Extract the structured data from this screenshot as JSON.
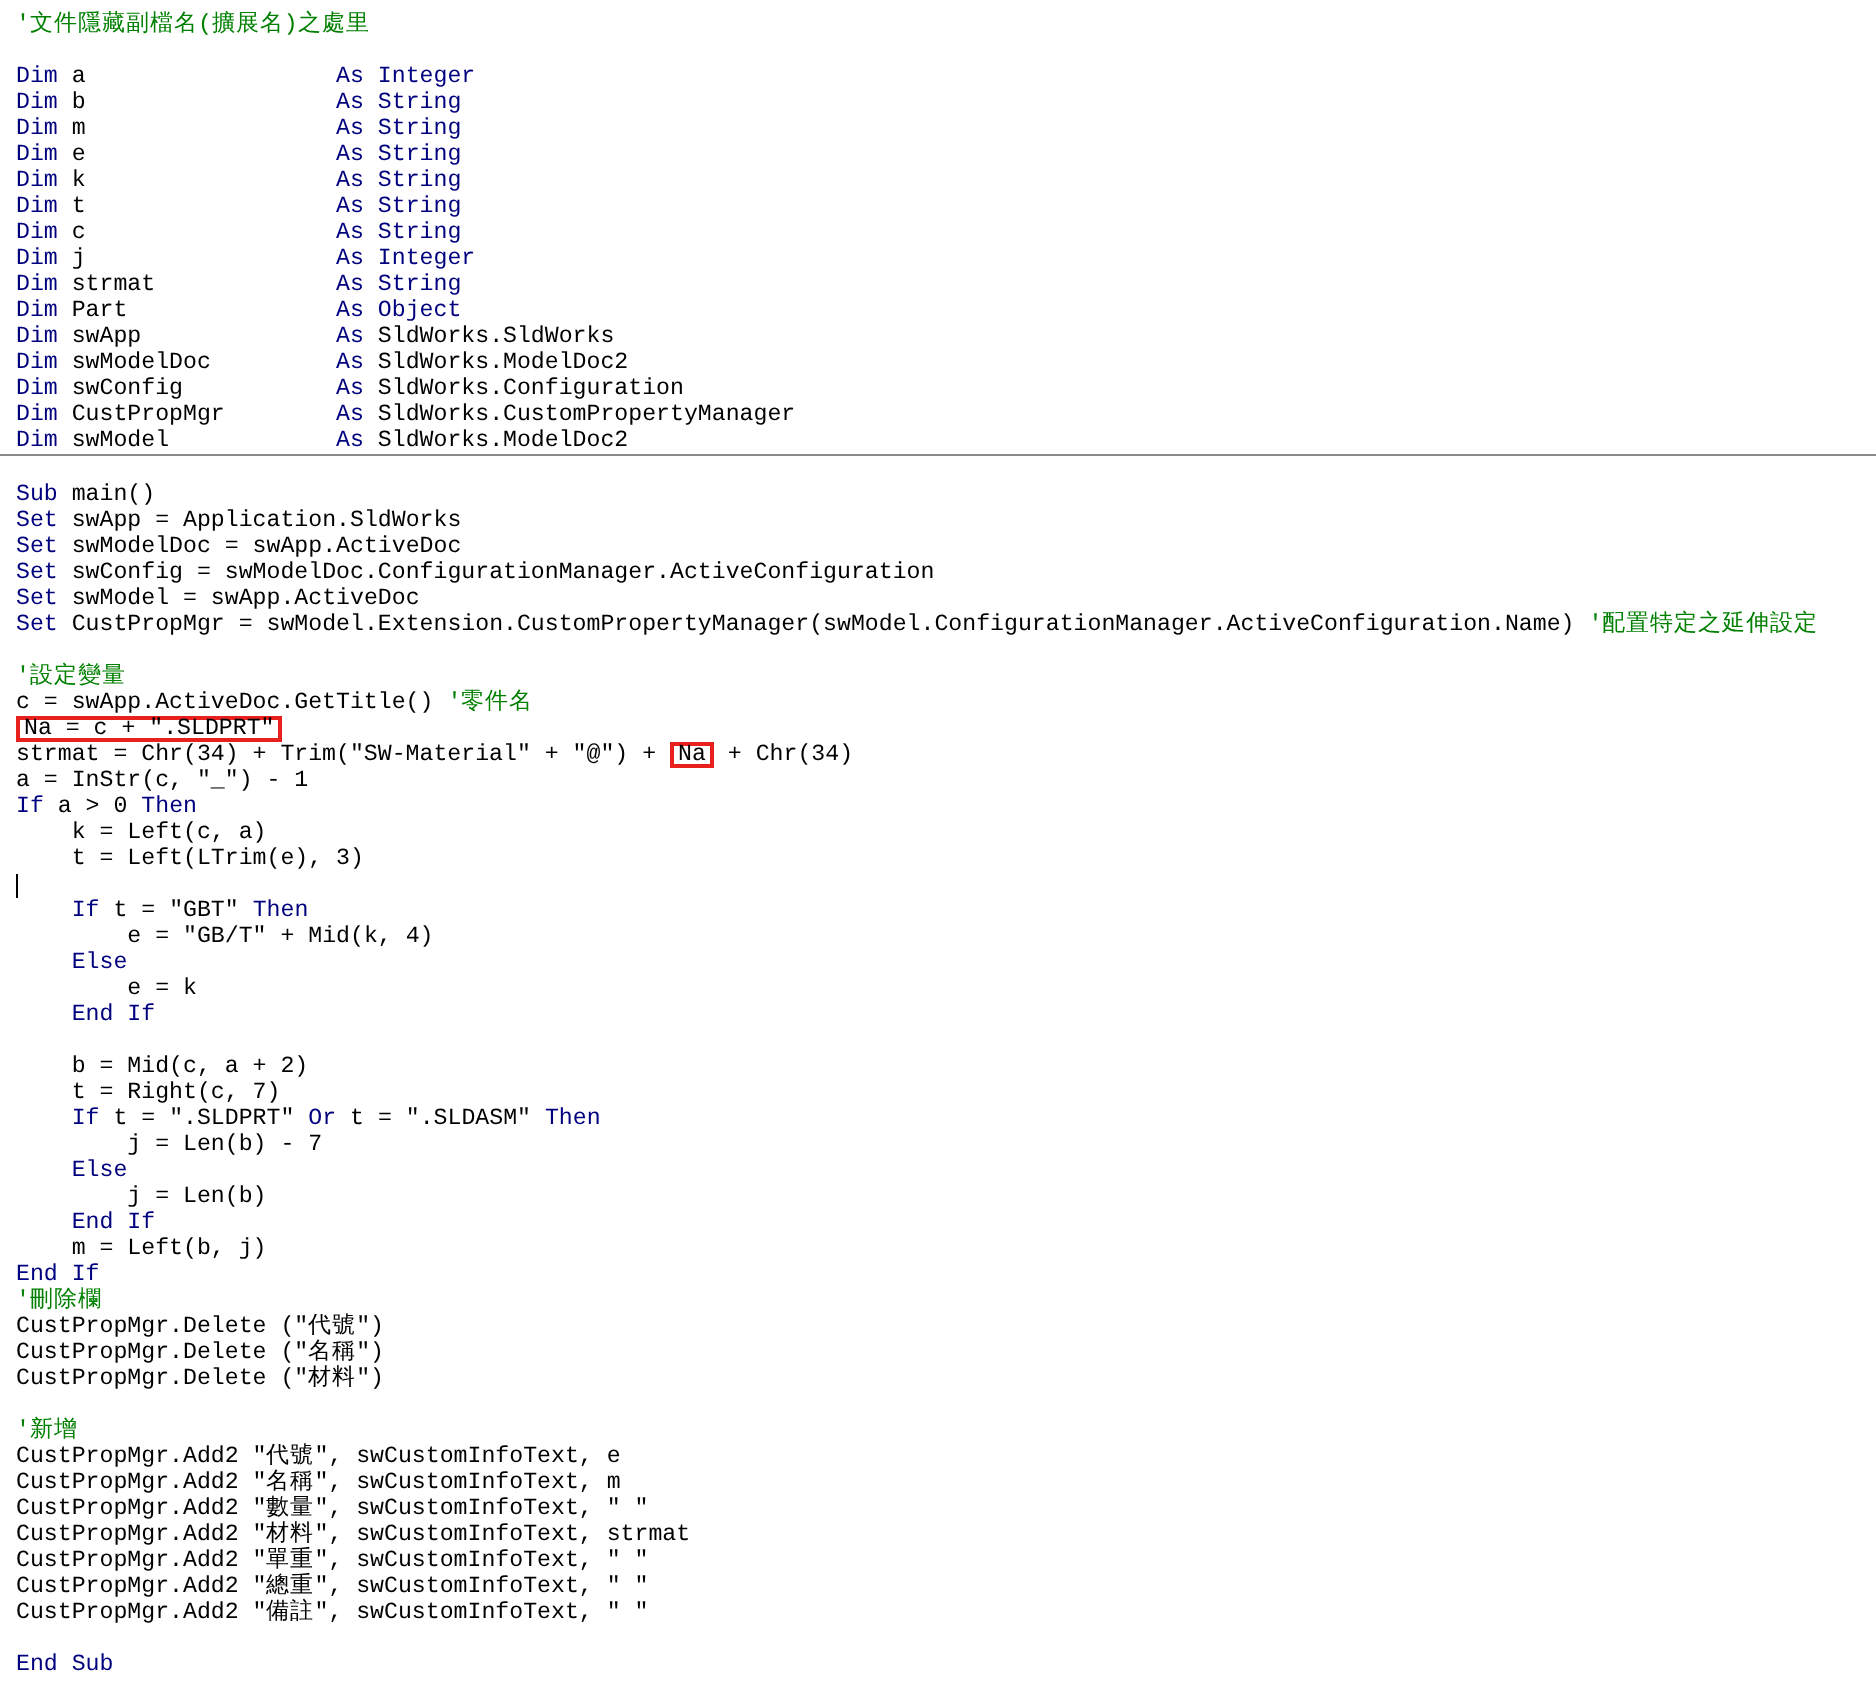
{
  "sections": [
    {
      "lines": [
        {
          "segments": [
            {
              "kind": "comment",
              "text": "'文件隱藏副檔名(擴展名)之處里"
            }
          ]
        },
        {
          "kind": "blank"
        },
        {
          "segments": [
            {
              "kind": "keyword",
              "text": "Dim"
            },
            {
              "kind": "text",
              "text": " a"
            }
          ],
          "aligned": [
            {
              "kind": "keyword",
              "text": "As"
            },
            {
              "kind": "keyword",
              "text": " Integer"
            }
          ]
        },
        {
          "segments": [
            {
              "kind": "keyword",
              "text": "Dim"
            },
            {
              "kind": "text",
              "text": " b"
            }
          ],
          "aligned": [
            {
              "kind": "keyword",
              "text": "As"
            },
            {
              "kind": "keyword",
              "text": " String"
            }
          ]
        },
        {
          "segments": [
            {
              "kind": "keyword",
              "text": "Dim"
            },
            {
              "kind": "text",
              "text": " m"
            }
          ],
          "aligned": [
            {
              "kind": "keyword",
              "text": "As"
            },
            {
              "kind": "keyword",
              "text": " String"
            }
          ]
        },
        {
          "segments": [
            {
              "kind": "keyword",
              "text": "Dim"
            },
            {
              "kind": "text",
              "text": " e"
            }
          ],
          "aligned": [
            {
              "kind": "keyword",
              "text": "As"
            },
            {
              "kind": "keyword",
              "text": " String"
            }
          ]
        },
        {
          "segments": [
            {
              "kind": "keyword",
              "text": "Dim"
            },
            {
              "kind": "text",
              "text": " k"
            }
          ],
          "aligned": [
            {
              "kind": "keyword",
              "text": "As"
            },
            {
              "kind": "keyword",
              "text": " String"
            }
          ]
        },
        {
          "segments": [
            {
              "kind": "keyword",
              "text": "Dim"
            },
            {
              "kind": "text",
              "text": " t"
            }
          ],
          "aligned": [
            {
              "kind": "keyword",
              "text": "As"
            },
            {
              "kind": "keyword",
              "text": " String"
            }
          ]
        },
        {
          "segments": [
            {
              "kind": "keyword",
              "text": "Dim"
            },
            {
              "kind": "text",
              "text": " c"
            }
          ],
          "aligned": [
            {
              "kind": "keyword",
              "text": "As"
            },
            {
              "kind": "keyword",
              "text": " String"
            }
          ]
        },
        {
          "segments": [
            {
              "kind": "keyword",
              "text": "Dim"
            },
            {
              "kind": "text",
              "text": " j"
            }
          ],
          "aligned": [
            {
              "kind": "keyword",
              "text": "As"
            },
            {
              "kind": "keyword",
              "text": " Integer"
            }
          ]
        },
        {
          "segments": [
            {
              "kind": "keyword",
              "text": "Dim"
            },
            {
              "kind": "text",
              "text": " strmat"
            }
          ],
          "aligned": [
            {
              "kind": "keyword",
              "text": "As"
            },
            {
              "kind": "keyword",
              "text": " String"
            }
          ]
        },
        {
          "segments": [
            {
              "kind": "keyword",
              "text": "Dim"
            },
            {
              "kind": "text",
              "text": " Part"
            }
          ],
          "aligned": [
            {
              "kind": "keyword",
              "text": "As"
            },
            {
              "kind": "keyword",
              "text": " Object"
            }
          ]
        },
        {
          "segments": [
            {
              "kind": "keyword",
              "text": "Dim"
            },
            {
              "kind": "text",
              "text": " swApp"
            }
          ],
          "aligned": [
            {
              "kind": "keyword",
              "text": "As"
            },
            {
              "kind": "text",
              "text": " SldWorks.SldWorks"
            }
          ]
        },
        {
          "segments": [
            {
              "kind": "keyword",
              "text": "Dim"
            },
            {
              "kind": "text",
              "text": " swModelDoc"
            }
          ],
          "aligned": [
            {
              "kind": "keyword",
              "text": "As"
            },
            {
              "kind": "text",
              "text": " SldWorks.ModelDoc2"
            }
          ]
        },
        {
          "segments": [
            {
              "kind": "keyword",
              "text": "Dim"
            },
            {
              "kind": "text",
              "text": " swConfig"
            }
          ],
          "aligned": [
            {
              "kind": "keyword",
              "text": "As"
            },
            {
              "kind": "text",
              "text": " SldWorks.Configuration"
            }
          ]
        },
        {
          "segments": [
            {
              "kind": "keyword",
              "text": "Dim"
            },
            {
              "kind": "text",
              "text": " CustPropMgr"
            }
          ],
          "aligned": [
            {
              "kind": "keyword",
              "text": "As"
            },
            {
              "kind": "text",
              "text": " SldWorks.CustomPropertyManager"
            }
          ]
        },
        {
          "segments": [
            {
              "kind": "keyword",
              "text": "Dim"
            },
            {
              "kind": "text",
              "text": " swModel"
            }
          ],
          "aligned": [
            {
              "kind": "keyword",
              "text": "As"
            },
            {
              "kind": "text",
              "text": " SldWorks.ModelDoc2"
            }
          ]
        }
      ]
    },
    {
      "lines": [
        {
          "kind": "blank"
        },
        {
          "segments": [
            {
              "kind": "keyword",
              "text": "Sub"
            },
            {
              "kind": "text",
              "text": " main()"
            }
          ]
        },
        {
          "segments": [
            {
              "kind": "keyword",
              "text": "Set"
            },
            {
              "kind": "text",
              "text": " swApp = Application.SldWorks"
            }
          ]
        },
        {
          "segments": [
            {
              "kind": "keyword",
              "text": "Set"
            },
            {
              "kind": "text",
              "text": " swModelDoc = swApp.ActiveDoc"
            }
          ]
        },
        {
          "segments": [
            {
              "kind": "keyword",
              "text": "Set"
            },
            {
              "kind": "text",
              "text": " swConfig = swModelDoc.ConfigurationManager.ActiveConfiguration"
            }
          ]
        },
        {
          "segments": [
            {
              "kind": "keyword",
              "text": "Set"
            },
            {
              "kind": "text",
              "text": " swModel = swApp.ActiveDoc"
            }
          ]
        },
        {
          "segments": [
            {
              "kind": "keyword",
              "text": "Set"
            },
            {
              "kind": "text",
              "text": " CustPropMgr = swModel.Extension.CustomPropertyManager(swModel.ConfigurationManager.ActiveConfiguration.Name)"
            },
            {
              "kind": "comment",
              "text": "'配置特定之延伸設定"
            }
          ]
        },
        {
          "kind": "blank"
        },
        {
          "segments": [
            {
              "kind": "comment",
              "text": "'設定變量"
            }
          ]
        },
        {
          "segments": [
            {
              "kind": "text",
              "text": "c = swApp.ActiveDoc.GetTitle()"
            },
            {
              "kind": "comment",
              "text": "'零件名"
            }
          ]
        },
        {
          "segments": [
            {
              "kind": "text",
              "text": "Na = c + \".SLDPRT\"",
              "boxed": true
            }
          ]
        },
        {
          "segments": [
            {
              "kind": "text",
              "text": "strmat = Chr(34) + Trim(\"SW-Material\" + \"@\") +"
            },
            {
              "kind": "text",
              "text": "Na",
              "boxed": true
            },
            {
              "kind": "text",
              "text": "+ Chr(34)"
            }
          ]
        },
        {
          "segments": [
            {
              "kind": "text",
              "text": "a = InStr(c, \"_\") - 1"
            }
          ]
        },
        {
          "segments": [
            {
              "kind": "keyword",
              "text": "If"
            },
            {
              "kind": "text",
              "text": "a > 0"
            },
            {
              "kind": "keyword",
              "text": "Then"
            }
          ]
        },
        {
          "segments": [
            {
              "kind": "text",
              "text": "    k = Left(c, a)"
            }
          ]
        },
        {
          "segments": [
            {
              "kind": "text",
              "text": "    t = Left(LTrim(e), 3)"
            }
          ]
        },
        {
          "caret": true
        },
        {
          "segments": [
            {
              "kind": "keyword",
              "text": "    If"
            },
            {
              "kind": "text",
              "text": "t = \"GBT\""
            },
            {
              "kind": "keyword",
              "text": "Then"
            }
          ]
        },
        {
          "segments": [
            {
              "kind": "text",
              "text": "        e = \"GB/T\" + Mid(k, 4)"
            }
          ]
        },
        {
          "segments": [
            {
              "kind": "keyword",
              "text": "    Else"
            }
          ]
        },
        {
          "segments": [
            {
              "kind": "text",
              "text": "        e = k"
            }
          ]
        },
        {
          "segments": [
            {
              "kind": "keyword",
              "text": "    End If"
            }
          ]
        },
        {
          "kind": "blank"
        },
        {
          "segments": [
            {
              "kind": "text",
              "text": "    b = Mid(c, a + 2)"
            }
          ]
        },
        {
          "segments": [
            {
              "kind": "text",
              "text": "    t = Right(c, 7)"
            }
          ]
        },
        {
          "segments": [
            {
              "kind": "keyword",
              "text": "    If"
            },
            {
              "kind": "text",
              "text": "t = \".SLDPRT\""
            },
            {
              "kind": "keyword",
              "text": "Or"
            },
            {
              "kind": "text",
              "text": "t = \".SLDASM\""
            },
            {
              "kind": "keyword",
              "text": "Then"
            }
          ]
        },
        {
          "segments": [
            {
              "kind": "text",
              "text": "        j = Len(b) - 7"
            }
          ]
        },
        {
          "segments": [
            {
              "kind": "keyword",
              "text": "    Else"
            }
          ]
        },
        {
          "segments": [
            {
              "kind": "text",
              "text": "        j = Len(b)"
            }
          ]
        },
        {
          "segments": [
            {
              "kind": "keyword",
              "text": "    End If"
            }
          ]
        },
        {
          "segments": [
            {
              "kind": "text",
              "text": "    m = Left(b, j)"
            }
          ]
        },
        {
          "segments": [
            {
              "kind": "keyword",
              "text": "End If"
            }
          ]
        },
        {
          "segments": [
            {
              "kind": "comment",
              "text": "'刪除欄"
            }
          ]
        },
        {
          "segments": [
            {
              "kind": "text",
              "text": "CustPropMgr.Delete (\"代號\")"
            }
          ]
        },
        {
          "segments": [
            {
              "kind": "text",
              "text": "CustPropMgr.Delete (\"名稱\")"
            }
          ]
        },
        {
          "segments": [
            {
              "kind": "text",
              "text": "CustPropMgr.Delete (\"材料\")"
            }
          ]
        },
        {
          "kind": "blank"
        },
        {
          "segments": [
            {
              "kind": "comment",
              "text": "'新增"
            }
          ]
        },
        {
          "segments": [
            {
              "kind": "text",
              "text": "CustPropMgr.Add2 \"代號\", swCustomInfoText, e"
            }
          ]
        },
        {
          "segments": [
            {
              "kind": "text",
              "text": "CustPropMgr.Add2 \"名稱\", swCustomInfoText, m"
            }
          ]
        },
        {
          "segments": [
            {
              "kind": "text",
              "text": "CustPropMgr.Add2 \"數量\", swCustomInfoText, \" \""
            }
          ]
        },
        {
          "segments": [
            {
              "kind": "text",
              "text": "CustPropMgr.Add2 \"材料\", swCustomInfoText, strmat"
            }
          ]
        },
        {
          "segments": [
            {
              "kind": "text",
              "text": "CustPropMgr.Add2 \"單重\", swCustomInfoText, \" \""
            }
          ]
        },
        {
          "segments": [
            {
              "kind": "text",
              "text": "CustPropMgr.Add2 \"總重\", swCustomInfoText, \" \""
            }
          ]
        },
        {
          "segments": [
            {
              "kind": "text",
              "text": "CustPropMgr.Add2 \"備註\", swCustomInfoText, \" \""
            }
          ]
        },
        {
          "kind": "blank"
        },
        {
          "segments": [
            {
              "kind": "keyword",
              "text": "End Sub"
            }
          ]
        }
      ]
    }
  ]
}
